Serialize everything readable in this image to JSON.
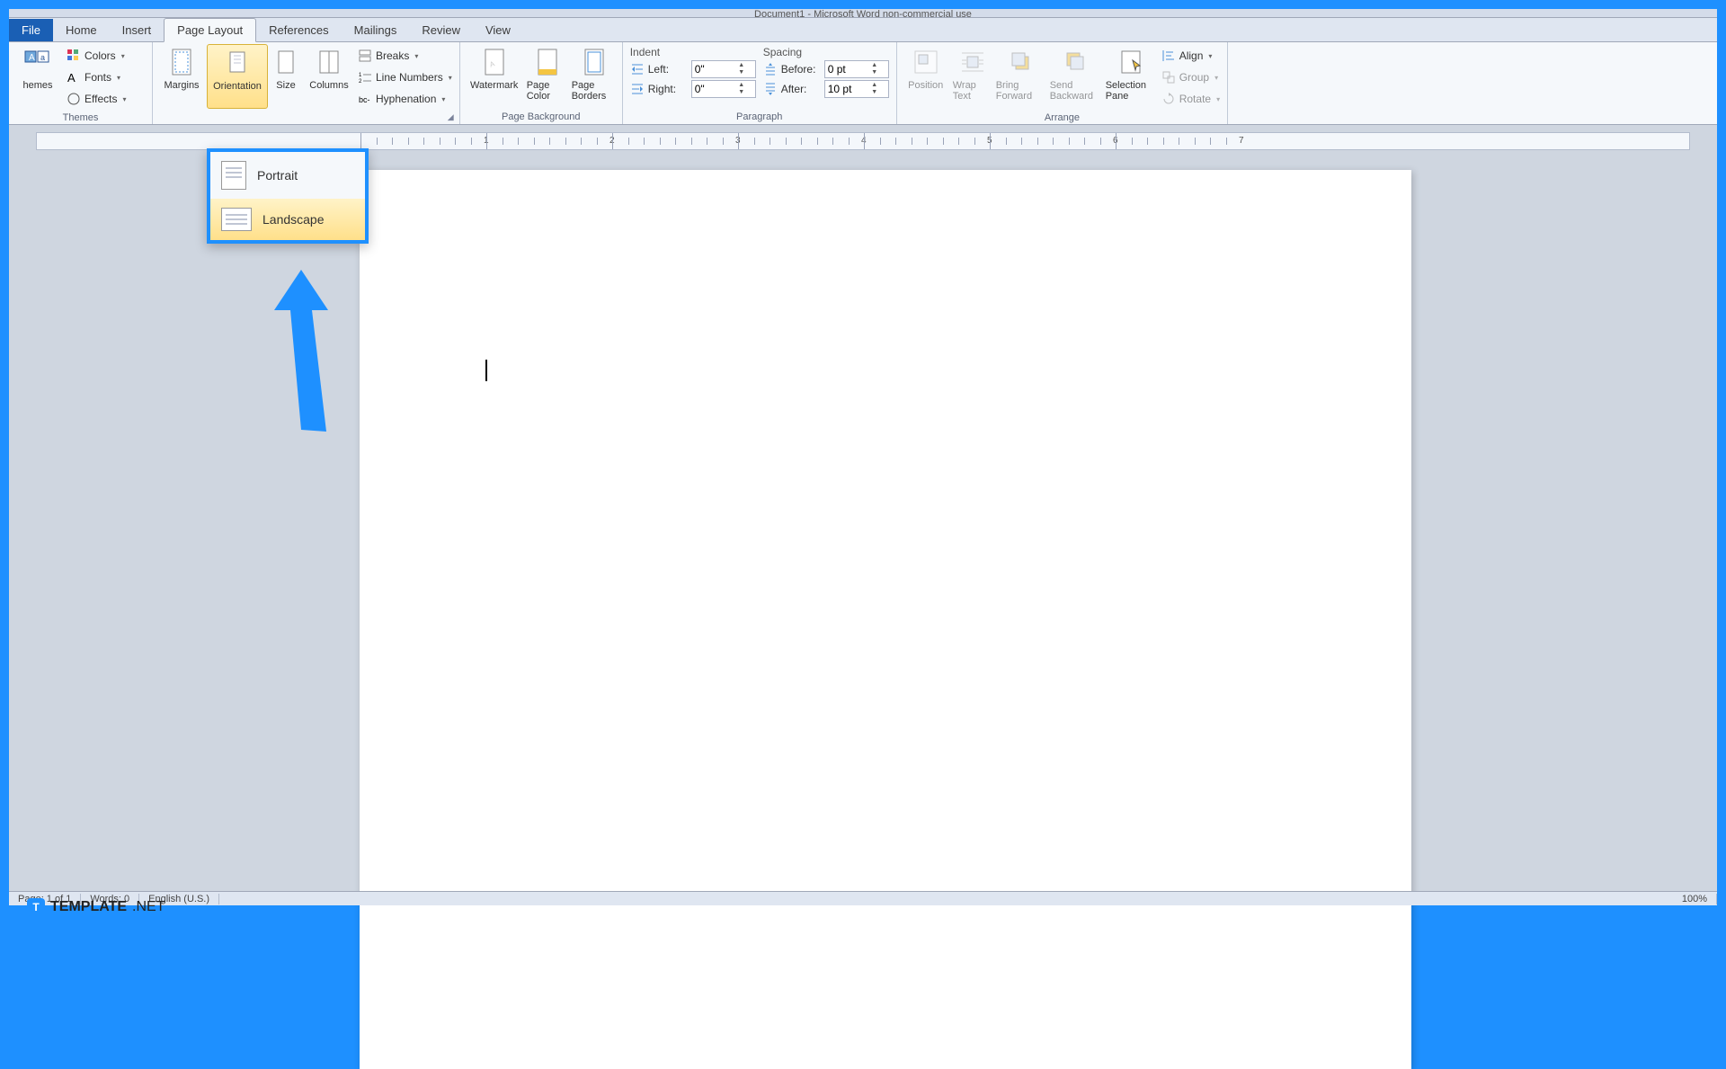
{
  "title": "Document1 - Microsoft Word non-commercial use",
  "tabs": {
    "file": "File",
    "home": "Home",
    "insert": "Insert",
    "page_layout": "Page Layout",
    "references": "References",
    "mailings": "Mailings",
    "review": "Review",
    "view": "View"
  },
  "groups": {
    "themes": {
      "label": "Themes",
      "themes_btn": "hemes",
      "colors": "Colors",
      "fonts": "Fonts",
      "effects": "Effects"
    },
    "page_setup": {
      "margins": "Margins",
      "orientation": "Orientation",
      "size": "Size",
      "columns": "Columns",
      "breaks": "Breaks",
      "line_numbers": "Line Numbers",
      "hyphenation": "Hyphenation"
    },
    "page_background": {
      "label": "Page Background",
      "watermark": "Watermark",
      "page_color": "Page Color",
      "page_borders": "Page Borders"
    },
    "paragraph": {
      "label": "Paragraph",
      "indent_label": "Indent",
      "left_label": "Left:",
      "right_label": "Right:",
      "left_value": "0\"",
      "right_value": "0\"",
      "spacing_label": "Spacing",
      "before_label": "Before:",
      "after_label": "After:",
      "before_value": "0 pt",
      "after_value": "10 pt"
    },
    "arrange": {
      "label": "Arrange",
      "position": "Position",
      "wrap_text": "Wrap Text",
      "bring_forward": "Bring Forward",
      "send_backward": "Send Backward",
      "selection_pane": "Selection Pane",
      "align": "Align",
      "group": "Group",
      "rotate": "Rotate"
    }
  },
  "orientation_dropdown": {
    "portrait": "Portrait",
    "landscape": "Landscape"
  },
  "ruler_numbers": [
    "1",
    "2",
    "3",
    "4",
    "5",
    "6",
    "7"
  ],
  "status": {
    "page": "Page: 1 of 1",
    "words": "Words: 0",
    "language": "English (U.S.)",
    "zoom": "100%"
  },
  "watermark_brand": {
    "main": "TEMPLATE",
    "suffix": ".NET"
  }
}
